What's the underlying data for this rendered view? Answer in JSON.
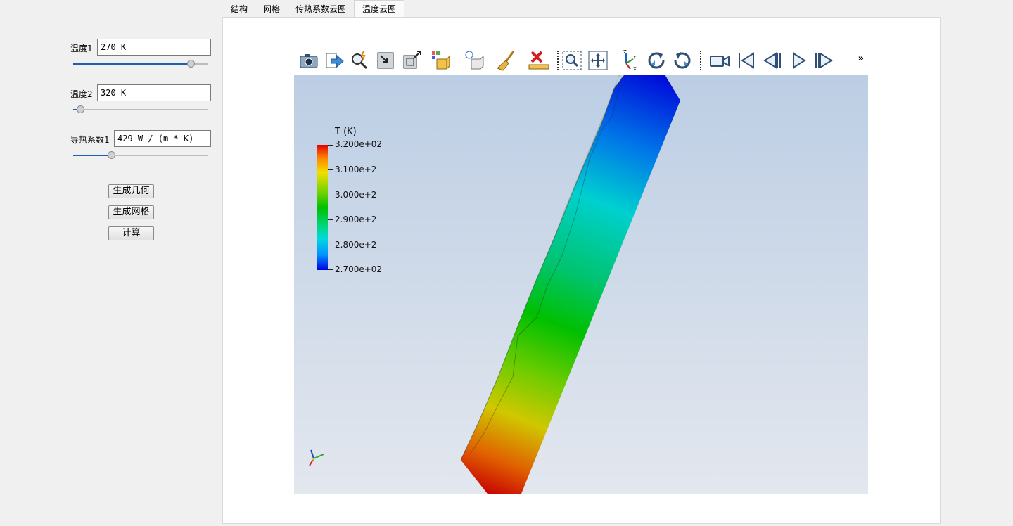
{
  "tabs": [
    "结构",
    "网格",
    "传热系数云图",
    "温度云图"
  ],
  "active_tab": 3,
  "params": {
    "temp1": {
      "label": "温度1",
      "value": "270 K",
      "slider_fraction": 0.87
    },
    "temp2": {
      "label": "温度2",
      "value": "320 K",
      "slider_fraction": 0.05
    },
    "conductivity": {
      "label": "导热系数1",
      "value": "429 W / (m * K)",
      "slider_fraction": 0.28
    }
  },
  "buttons": {
    "generate_geometry": "生成几何",
    "generate_mesh": "生成网格",
    "compute": "计算"
  },
  "toolbar": {
    "icons": [
      "camera-icon",
      "export-icon",
      "probe-icon",
      "reset-camera-icon",
      "zoom-to-box-icon",
      "representation-icon",
      "light-icon",
      "clear-icon",
      "ruler-icon",
      "zoom-select-icon",
      "fit-all-icon",
      "axes-orientation-icon",
      "rotate-cw-icon",
      "rotate-ccw-icon",
      "video-camera-icon",
      "first-frame-icon",
      "previous-frame-icon",
      "play-icon",
      "last-frame-icon"
    ],
    "overflow_label": "»"
  },
  "legend": {
    "title": "T (K)",
    "ticks": [
      "3.200e+02",
      "3.100e+2",
      "3.000e+2",
      "2.900e+2",
      "2.800e+2",
      "2.700e+02"
    ]
  },
  "colors": {
    "accent": "#1a5fb4",
    "scene_top": "#bccee4",
    "scene_bottom": "#e3e7ee"
  }
}
